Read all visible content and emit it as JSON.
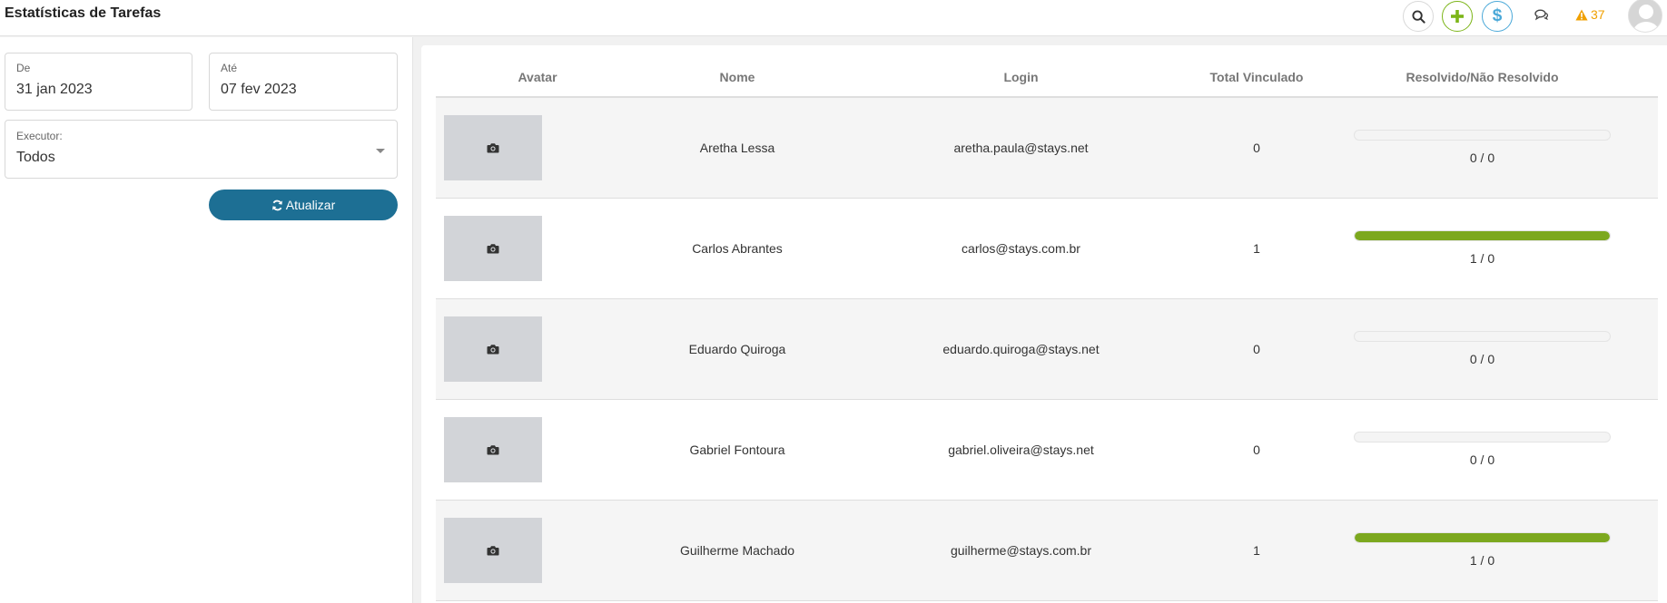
{
  "header": {
    "title": "Estatísticas de Tarefas",
    "alert_count": "37",
    "icons": [
      "search-icon",
      "plus-icon",
      "dollar-icon",
      "chat-icon",
      "warning-icon",
      "user-avatar"
    ],
    "colors": {
      "add": "#7cb518",
      "money": "#4aa8d8",
      "alert": "#f0a000"
    }
  },
  "filters": {
    "from_label": "De",
    "from_value": "31 jan 2023",
    "to_label": "Até",
    "to_value": "07 fev 2023",
    "executor_label": "Executor:",
    "executor_value": "Todos",
    "update_label": "Atualizar",
    "update_color": "#1d6f94"
  },
  "table": {
    "columns": [
      "Avatar",
      "Nome",
      "Login",
      "Total Vinculado",
      "Resolvido/Não Resolvido"
    ],
    "rows": [
      {
        "name": "Aretha Lessa",
        "login": "aretha.paula@stays.net",
        "total": "0",
        "ratio": "0 / 0",
        "progress": 0
      },
      {
        "name": "Carlos Abrantes",
        "login": "carlos@stays.com.br",
        "total": "1",
        "ratio": "1 / 0",
        "progress": 1
      },
      {
        "name": "Eduardo Quiroga",
        "login": "eduardo.quiroga@stays.net",
        "total": "0",
        "ratio": "0 / 0",
        "progress": 0
      },
      {
        "name": "Gabriel Fontoura",
        "login": "gabriel.oliveira@stays.net",
        "total": "0",
        "ratio": "0 / 0",
        "progress": 0
      },
      {
        "name": "Guilherme Machado",
        "login": "guilherme@stays.com.br",
        "total": "1",
        "ratio": "1 / 0",
        "progress": 1
      }
    ],
    "progress_color": "#7ca81e"
  }
}
